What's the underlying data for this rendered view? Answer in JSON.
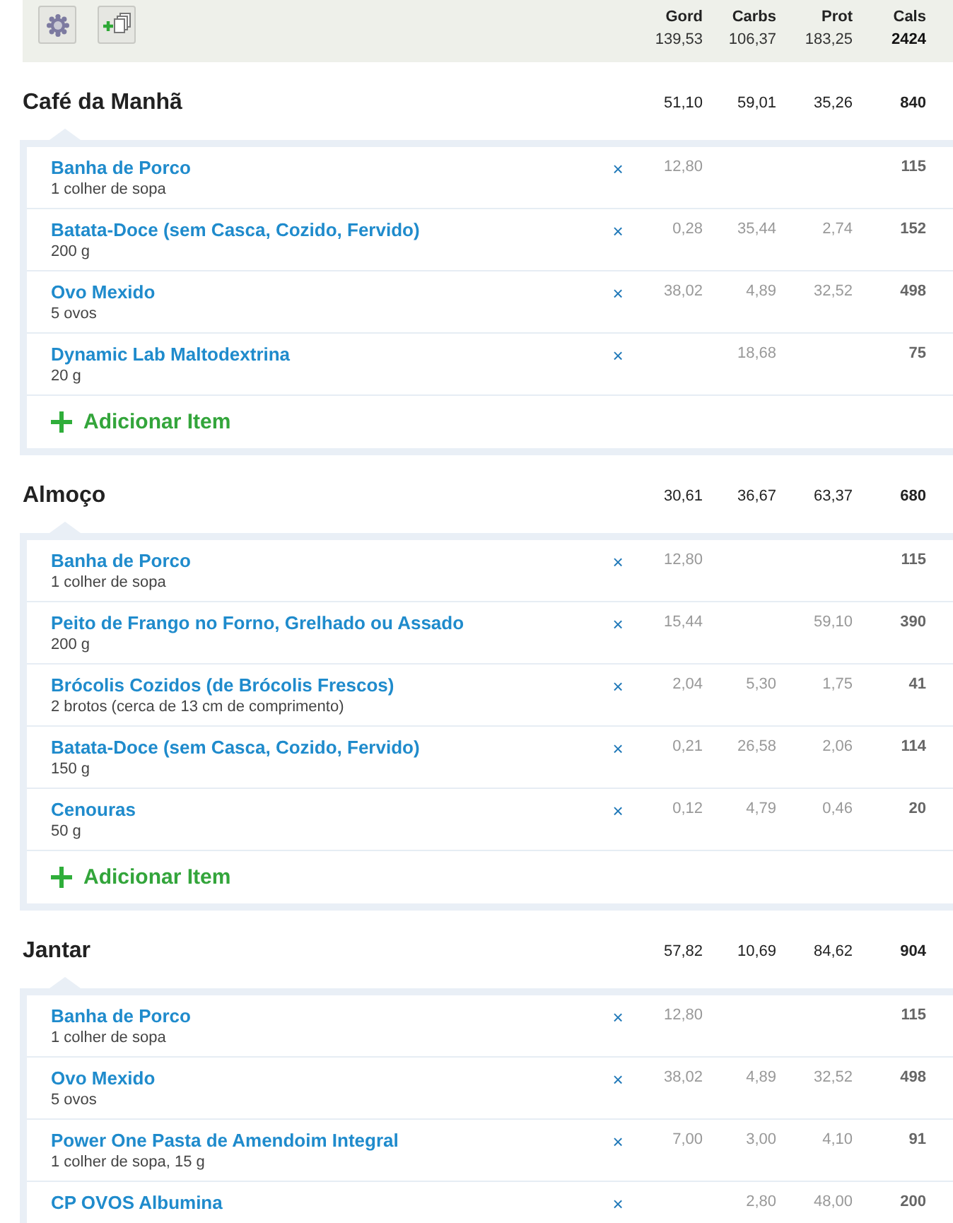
{
  "summary": {
    "columns": [
      {
        "label": "Gord",
        "value": "139,53"
      },
      {
        "label": "Carbs",
        "value": "106,37"
      },
      {
        "label": "Prot",
        "value": "183,25"
      },
      {
        "label": "Cals",
        "value": "2424"
      }
    ]
  },
  "meals": [
    {
      "title": "Café da Manhã",
      "totals": [
        "51,10",
        "59,01",
        "35,26",
        "840"
      ],
      "items": [
        {
          "name": "Banha de Porco",
          "serving": "1 colher de sopa",
          "remove": "×",
          "values": {
            "gord": "12,80",
            "cals": "115"
          }
        },
        {
          "name": "Batata-Doce (sem Casca, Cozido, Fervido)",
          "serving": "200 g",
          "remove": "×",
          "values": {
            "gord": "0,28",
            "carbs": "35,44",
            "prot": "2,74",
            "cals": "152"
          }
        },
        {
          "name": "Ovo Mexido",
          "serving": "5 ovos",
          "remove": "×",
          "values": {
            "gord": "38,02",
            "carbs": "4,89",
            "prot": "32,52",
            "cals": "498"
          }
        },
        {
          "name": "Dynamic Lab Maltodextrina",
          "serving": "20 g",
          "remove": "×",
          "values": {
            "carbs": "18,68",
            "cals": "75"
          }
        }
      ],
      "add_label": "Adicionar Item"
    },
    {
      "title": "Almoço",
      "totals": [
        "30,61",
        "36,67",
        "63,37",
        "680"
      ],
      "items": [
        {
          "name": "Banha de Porco",
          "serving": "1 colher de sopa",
          "remove": "×",
          "values": {
            "gord": "12,80",
            "cals": "115"
          }
        },
        {
          "name": "Peito de Frango no Forno, Grelhado ou Assado",
          "serving": "200 g",
          "remove": "×",
          "values": {
            "gord": "15,44",
            "prot": "59,10",
            "cals": "390"
          }
        },
        {
          "name": "Brócolis Cozidos (de Brócolis Frescos)",
          "serving": "2 brotos (cerca de 13 cm de comprimento)",
          "remove": "×",
          "values": {
            "gord": "2,04",
            "carbs": "5,30",
            "prot": "1,75",
            "cals": "41"
          }
        },
        {
          "name": "Batata-Doce (sem Casca, Cozido, Fervido)",
          "serving": "150 g",
          "remove": "×",
          "values": {
            "gord": "0,21",
            "carbs": "26,58",
            "prot": "2,06",
            "cals": "114"
          }
        },
        {
          "name": "Cenouras",
          "serving": "50 g",
          "remove": "×",
          "values": {
            "gord": "0,12",
            "carbs": "4,79",
            "prot": "0,46",
            "cals": "20"
          }
        }
      ],
      "add_label": "Adicionar Item"
    },
    {
      "title": "Jantar",
      "totals": [
        "57,82",
        "10,69",
        "84,62",
        "904"
      ],
      "items": [
        {
          "name": "Banha de Porco",
          "serving": "1 colher de sopa",
          "remove": "×",
          "values": {
            "gord": "12,80",
            "cals": "115"
          }
        },
        {
          "name": "Ovo Mexido",
          "serving": "5 ovos",
          "remove": "×",
          "values": {
            "gord": "38,02",
            "carbs": "4,89",
            "prot": "32,52",
            "cals": "498"
          }
        },
        {
          "name": "Power One Pasta de Amendoim Integral",
          "serving": "1 colher de sopa, 15 g",
          "remove": "×",
          "values": {
            "gord": "7,00",
            "carbs": "3,00",
            "prot": "4,10",
            "cals": "91"
          }
        },
        {
          "name": "CP OVOS Albumina",
          "remove": "×",
          "values": {
            "carbs": "2,80",
            "prot": "48,00",
            "cals": "200"
          }
        }
      ]
    }
  ]
}
